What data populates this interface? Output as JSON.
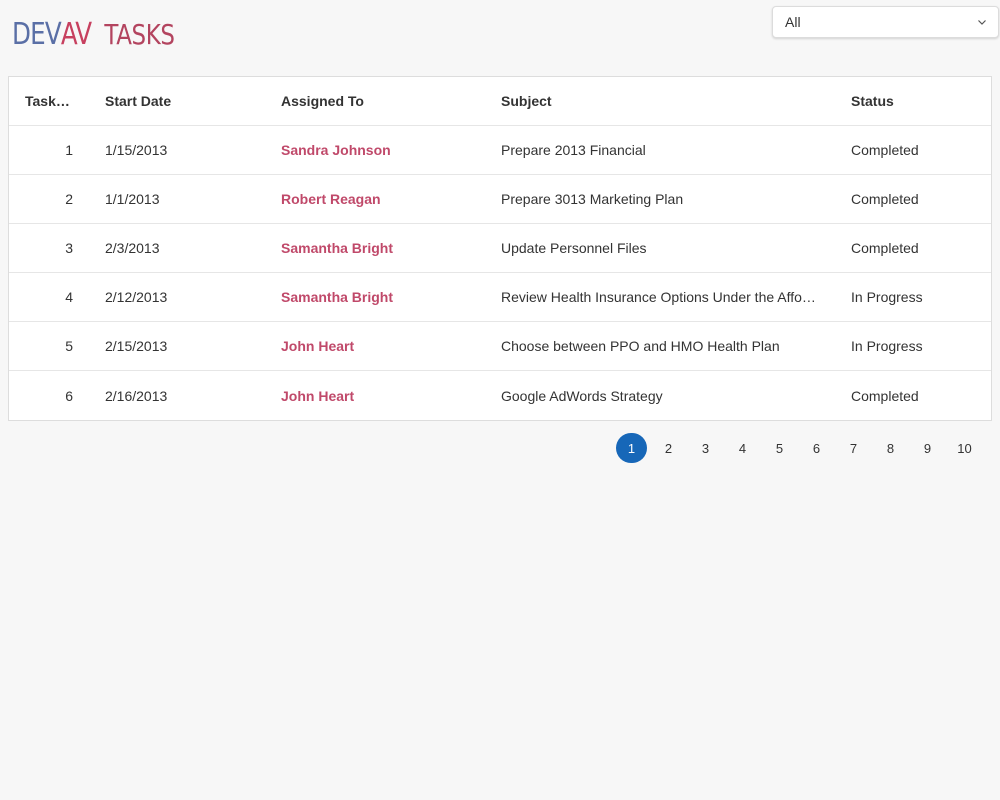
{
  "header": {
    "logo_dev": "DEV",
    "logo_av": "AV",
    "title": "TASKS"
  },
  "filter": {
    "selected": "All",
    "icon": "chevron-down-icon"
  },
  "grid": {
    "columns": [
      "Task…",
      "Start Date",
      "Assigned To",
      "Subject",
      "Status"
    ],
    "rows": [
      {
        "id": "1",
        "start": "1/15/2013",
        "assigned": "Sandra Johnson",
        "subject": "Prepare 2013 Financial",
        "status": "Completed"
      },
      {
        "id": "2",
        "start": "1/1/2013",
        "assigned": "Robert Reagan",
        "subject": "Prepare 3013 Marketing Plan",
        "status": "Completed"
      },
      {
        "id": "3",
        "start": "2/3/2013",
        "assigned": "Samantha Bright",
        "subject": "Update Personnel Files",
        "status": "Completed"
      },
      {
        "id": "4",
        "start": "2/12/2013",
        "assigned": "Samantha Bright",
        "subject": "Review Health Insurance Options Under the Affo…",
        "status": "In Progress"
      },
      {
        "id": "5",
        "start": "2/15/2013",
        "assigned": "John Heart",
        "subject": "Choose between PPO and HMO Health Plan",
        "status": "In Progress"
      },
      {
        "id": "6",
        "start": "2/16/2013",
        "assigned": "John Heart",
        "subject": "Google AdWords Strategy",
        "status": "Completed"
      }
    ]
  },
  "pager": {
    "pages": [
      "1",
      "2",
      "3",
      "4",
      "5",
      "6",
      "7",
      "8",
      "9",
      "10"
    ],
    "active": "1"
  },
  "colors": {
    "logo_dev": "#5a6fa6",
    "logo_accent": "#c7405f",
    "assigned_link": "#c0496a",
    "active_page": "#1767b8"
  }
}
